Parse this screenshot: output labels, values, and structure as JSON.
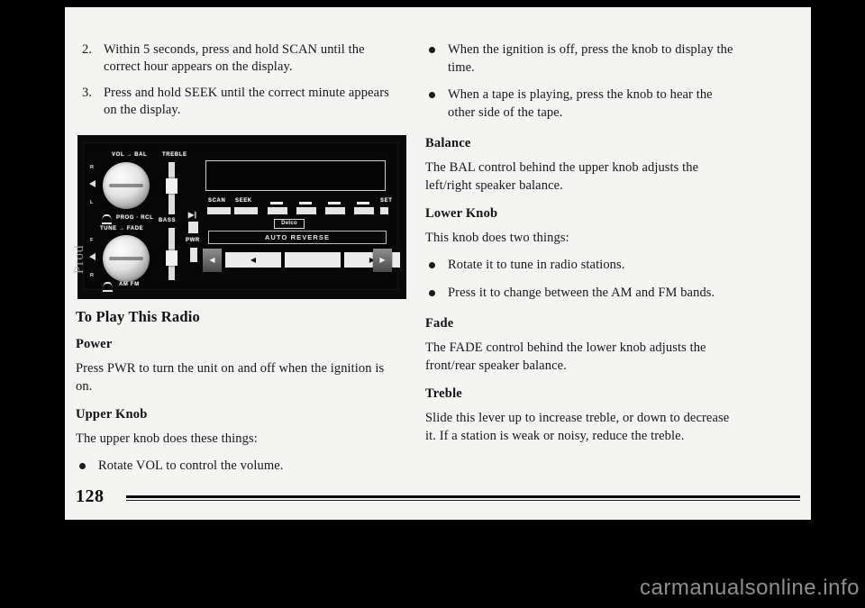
{
  "page": {
    "number": "128",
    "watermark": "carmanualsonline.info",
    "scan_artifact": "Prod"
  },
  "left_column": {
    "steps": [
      {
        "num": "2.",
        "text": "Within 5 seconds, press and hold SCAN until the correct hour appears on the display."
      },
      {
        "num": "3.",
        "text": "Press and hold SEEK until the correct minute appears on the display."
      }
    ],
    "figure": {
      "alt": "Delco AM/FM cassette radio faceplate",
      "labels": {
        "vol_bal": "VOL → BAL",
        "treble": "TREBLE",
        "bass": "BASS",
        "prog_rcl": "PROG · RCL",
        "tune_fade": "TUNE → FADE",
        "am_fm": "AM FM",
        "pwr": "PWR",
        "scan": "SCAN",
        "seek": "SEEK",
        "set": "SET",
        "delco": "Delco",
        "auto_reverse": "AUTO REVERSE",
        "mark_r": "R",
        "mark_l": "L",
        "mark_f": "F",
        "mark_rear": "R",
        "tape_icon": "▶|",
        "rewind_arrow": "◀",
        "left_arrow": "◀",
        "right_arrow": "▶",
        "eject_arrow": "▶"
      }
    },
    "heading": "To Play This Radio",
    "sections": [
      {
        "title": "Power",
        "body": "Press PWR to turn the unit on and off when the ignition is on."
      },
      {
        "title": "Upper Knob",
        "body": "The upper knob does these things:",
        "bullets": [
          "Rotate VOL to control the volume."
        ]
      }
    ]
  },
  "right_column": {
    "top_bullets": [
      "When the ignition is off, press the knob to display the time.",
      "When a tape is playing, press the knob to hear the other side of the tape."
    ],
    "sections": [
      {
        "title": "Balance",
        "body": "The BAL control behind the upper knob adjusts the left/right speaker balance."
      },
      {
        "title": "Lower Knob",
        "body": "This knob does two things:",
        "bullets": [
          "Rotate it to tune in radio stations.",
          "Press it to change between the AM and FM bands."
        ]
      },
      {
        "title": "Fade",
        "body": "The FADE control behind the lower knob adjusts the front/rear speaker balance."
      },
      {
        "title": "Treble",
        "body": "Slide this lever up to increase treble, or down to decrease it. If a station is weak or noisy, reduce the treble."
      }
    ]
  }
}
